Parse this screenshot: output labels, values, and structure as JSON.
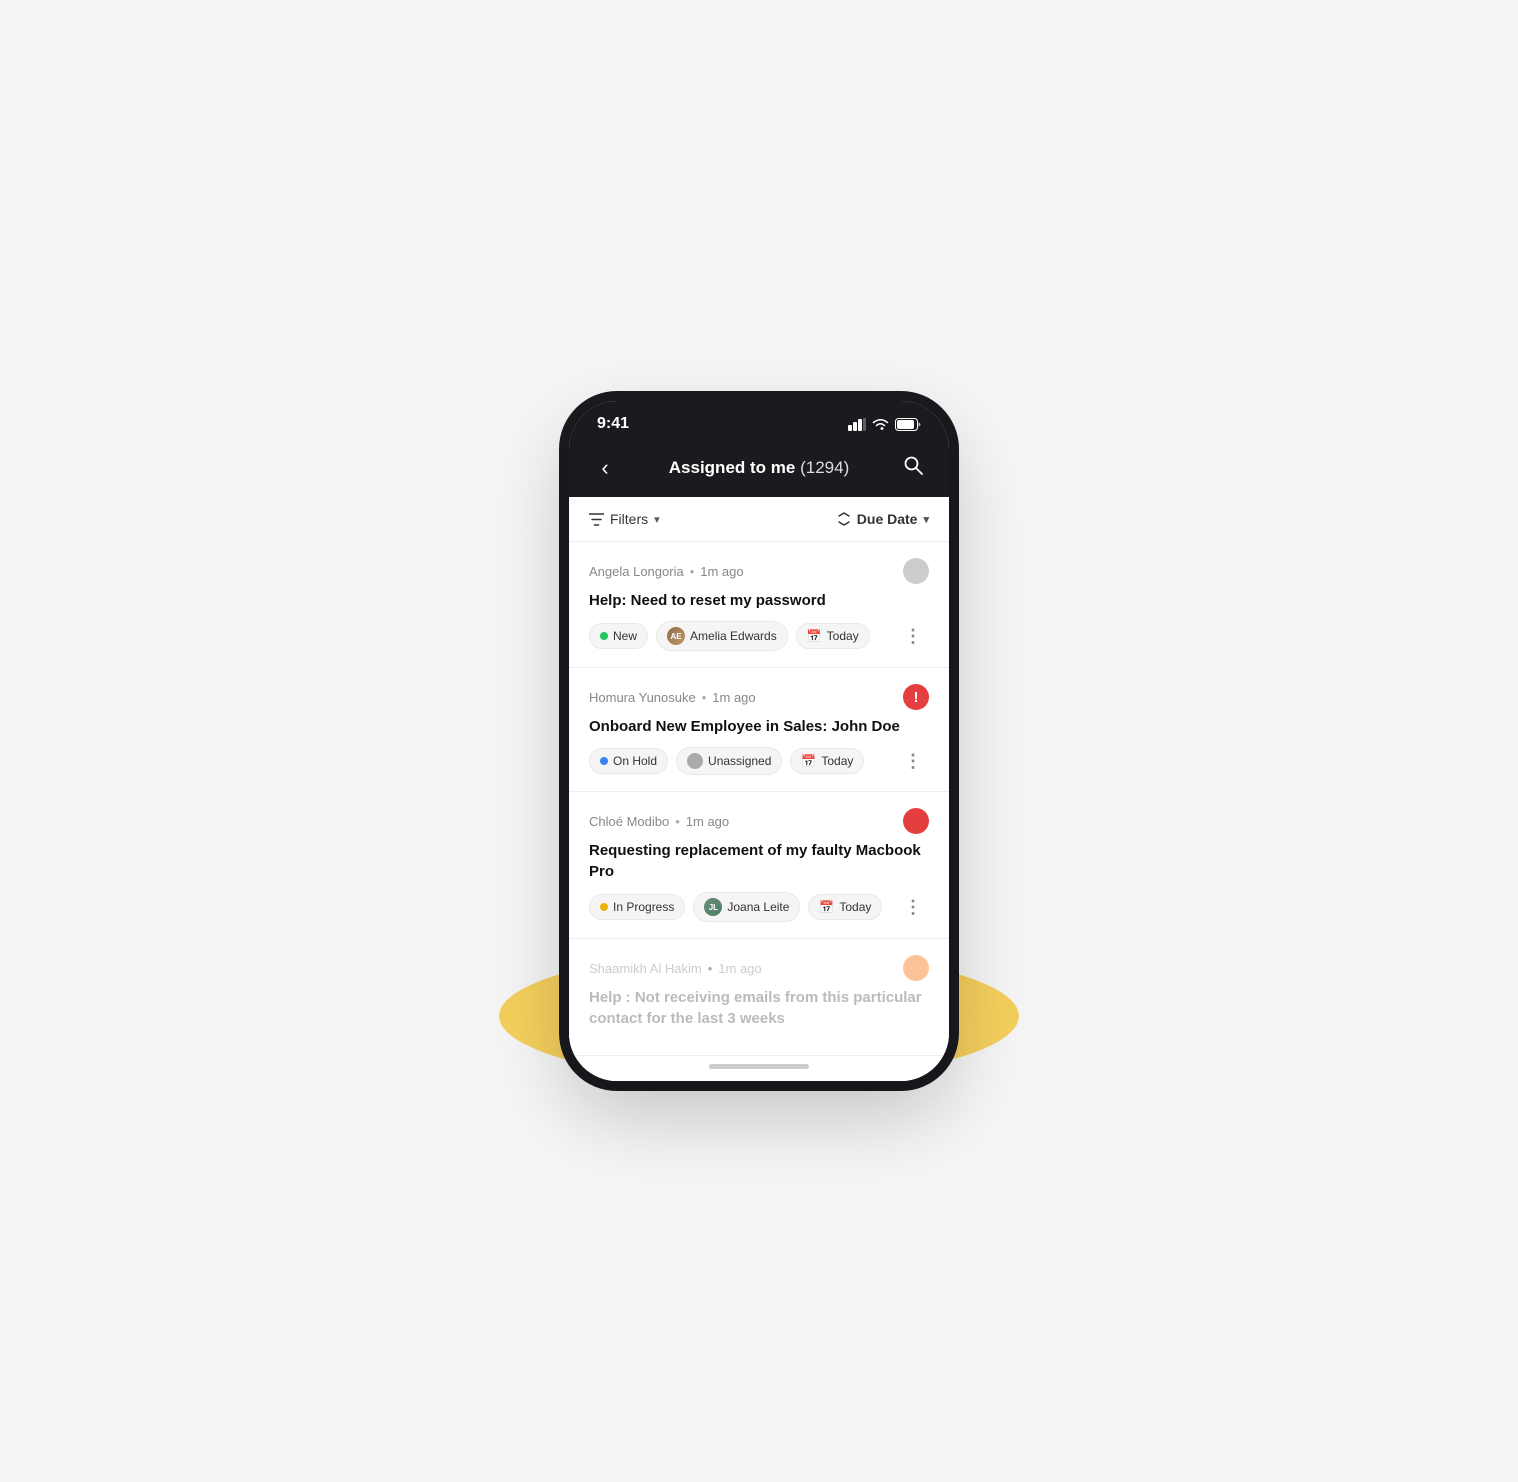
{
  "phone": {
    "status_bar": {
      "time": "9:41",
      "signal_icon": "▋▋▋",
      "wifi_icon": "wifi",
      "battery_icon": "battery"
    },
    "nav": {
      "back_label": "‹",
      "title": "Assigned to me",
      "count": "(1294)",
      "search_icon": "search"
    },
    "filter_bar": {
      "filter_label": "Filters",
      "sort_label": "Due Date"
    },
    "tickets": [
      {
        "id": "ticket-1",
        "author": "Angela Longoria",
        "time": "1m ago",
        "priority": "gray",
        "title": "Help: Need to reset my password",
        "status_label": "New",
        "status_dot": "green",
        "assignee_label": "Amelia Edwards",
        "assignee_type": "avatar",
        "assignee_initials": "AE",
        "due_label": "Today",
        "faded": false
      },
      {
        "id": "ticket-2",
        "author": "Homura Yunosuke",
        "time": "1m ago",
        "priority": "red-exclaim",
        "title": "Onboard New Employee in Sales: John Doe",
        "status_label": "On Hold",
        "status_dot": "blue",
        "assignee_label": "Unassigned",
        "assignee_type": "unassigned",
        "assignee_initials": "",
        "due_label": "Today",
        "faded": false
      },
      {
        "id": "ticket-3",
        "author": "Chloé Modibo",
        "time": "1m ago",
        "priority": "red",
        "title": "Requesting replacement of my faulty Macbook Pro",
        "status_label": "In Progress",
        "status_dot": "yellow",
        "assignee_label": "Joana Leite",
        "assignee_type": "avatar",
        "assignee_initials": "JL",
        "due_label": "Today",
        "faded": false
      },
      {
        "id": "ticket-4",
        "author": "Shaamikh Al Hakim",
        "time": "1m ago",
        "priority": "orange",
        "title": "Help : Not receiving emails from this particular contact for the last 3 weeks",
        "status_label": "",
        "status_dot": "",
        "assignee_label": "",
        "assignee_type": "",
        "assignee_initials": "",
        "due_label": "",
        "faded": true
      }
    ],
    "more_icon": "⋮"
  }
}
